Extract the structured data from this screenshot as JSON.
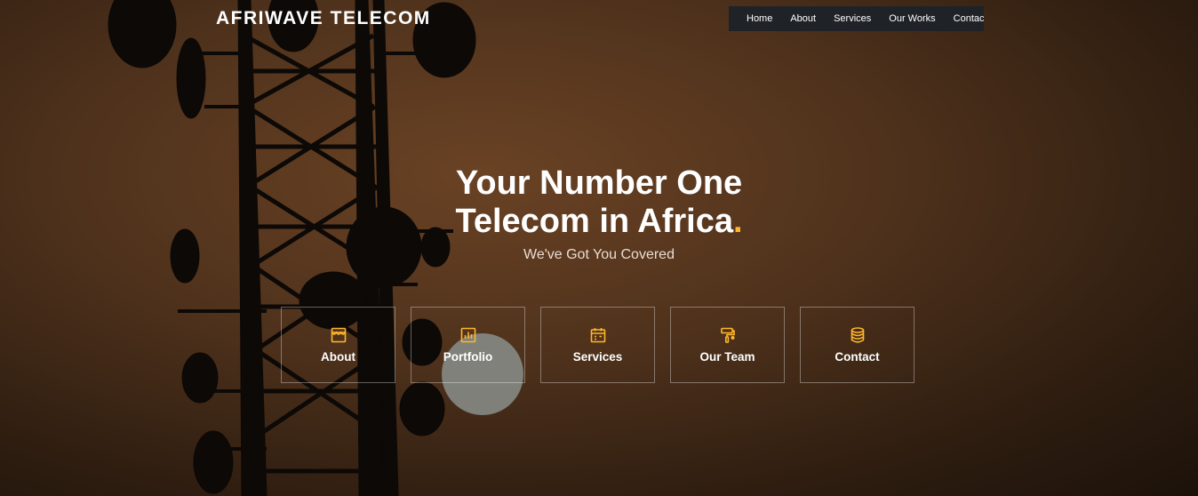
{
  "header": {
    "brand": "AFRIWAVE TELECOM"
  },
  "nav": {
    "items": [
      {
        "label": "Home"
      },
      {
        "label": "About"
      },
      {
        "label": "Services"
      },
      {
        "label": "Our Works"
      },
      {
        "label": "Contact"
      }
    ]
  },
  "hero": {
    "title_line1": "Your Number One",
    "title_line2": "Telecom in Africa",
    "title_dot": ".",
    "subtitle": "We've Got You Covered",
    "accent_color": "#ffb72b"
  },
  "icon_boxes": [
    {
      "label": "About",
      "icon": "store-icon"
    },
    {
      "label": "Portfolio",
      "icon": "bar-chart-icon"
    },
    {
      "label": "Services",
      "icon": "calendar-icon"
    },
    {
      "label": "Our Team",
      "icon": "paint-roller-icon"
    },
    {
      "label": "Contact",
      "icon": "database-icon"
    }
  ]
}
